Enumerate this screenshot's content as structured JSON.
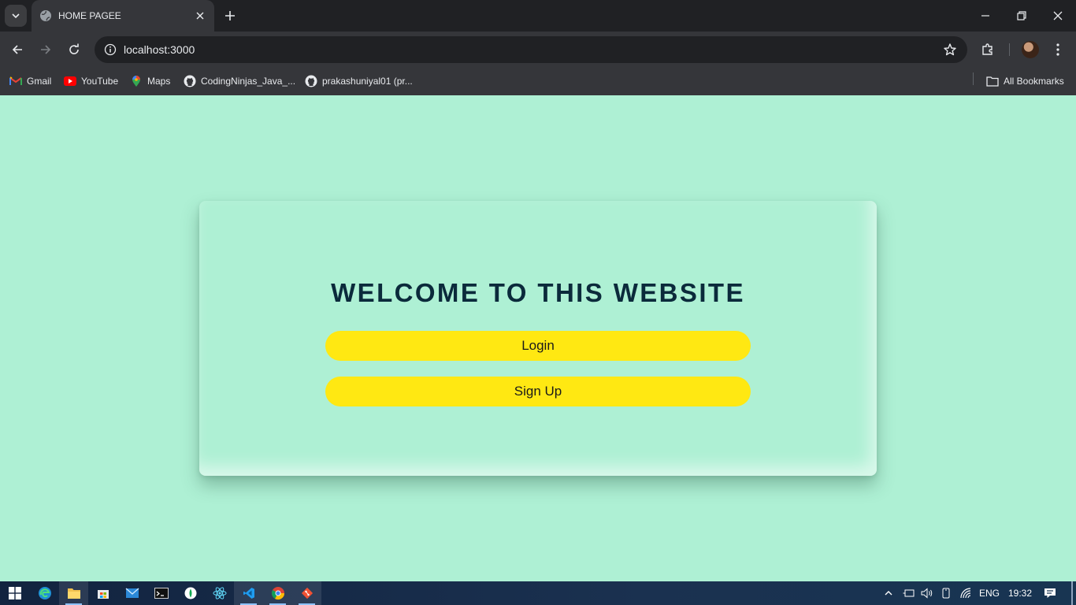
{
  "browser": {
    "tab_title": "HOME PAGEE",
    "url": "localhost:3000",
    "bookmarks": [
      {
        "label": "Gmail",
        "icon": "gmail-icon"
      },
      {
        "label": "YouTube",
        "icon": "youtube-icon"
      },
      {
        "label": "Maps",
        "icon": "maps-icon"
      },
      {
        "label": "CodingNinjas_Java_...",
        "icon": "github-icon"
      },
      {
        "label": "prakashuniyal01 (pr...",
        "icon": "github-icon"
      }
    ],
    "all_bookmarks_label": "All Bookmarks"
  },
  "page": {
    "heading": "WELCOME TO THIS WEBSITE",
    "login_label": "Login",
    "signup_label": "Sign Up"
  },
  "taskbar": {
    "language": "ENG",
    "time": "19:32",
    "apps": [
      "start",
      "edge",
      "file-explorer",
      "store",
      "mail",
      "terminal",
      "mongodb-compass",
      "react",
      "vscode",
      "chrome",
      "git"
    ]
  },
  "colors": {
    "page_background": "#aef0d4",
    "button": "#ffe812",
    "heading": "#0b2a3b"
  }
}
